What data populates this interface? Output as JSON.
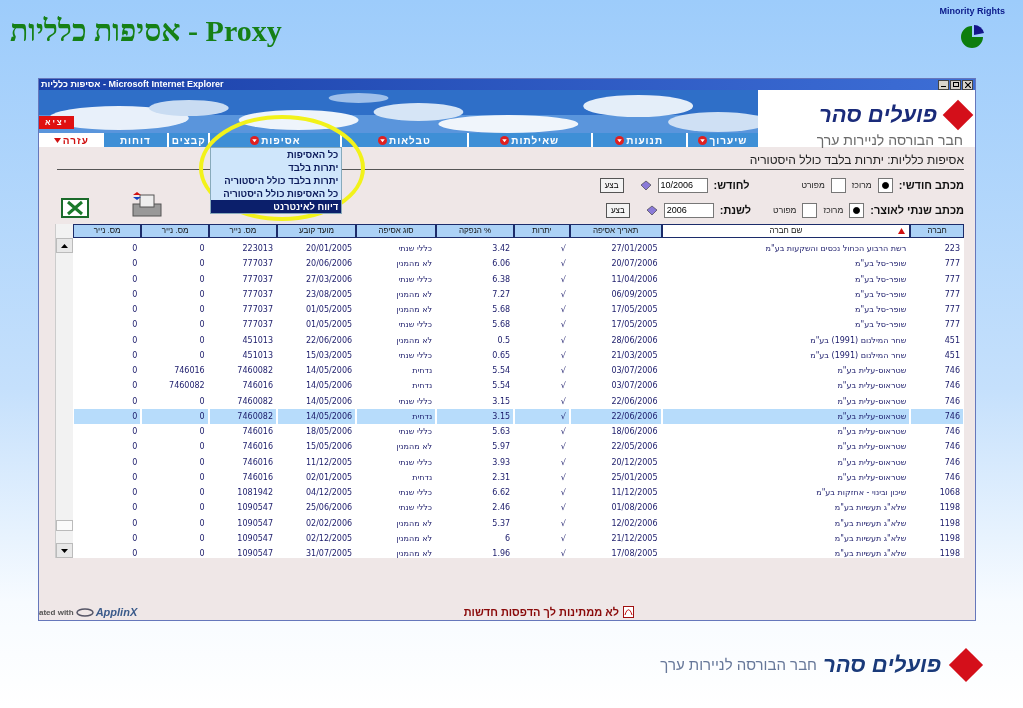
{
  "slide": {
    "title": "אסיפות כלליות - Proxy",
    "corner_label": "Minority Rights"
  },
  "window": {
    "title": "אסיפות כלליות - Microsoft Internet Explorer"
  },
  "banner": {
    "exit_button": "יציא",
    "logo_name": "פועלים סהר",
    "logo_tagline": "חבר הבורסה לניירות ערך"
  },
  "nav_tabs": [
    {
      "label": "שיערוך",
      "kind": "menu",
      "open": false
    },
    {
      "label": "תנועות",
      "kind": "menu",
      "open": false
    },
    {
      "label": "שאילתות",
      "kind": "menu",
      "open": false
    },
    {
      "label": "טבלאות",
      "kind": "menu",
      "open": false
    },
    {
      "label": "אסיפות",
      "kind": "menu",
      "open": true
    },
    {
      "label": "קבצים",
      "kind": "plain",
      "open": false
    },
    {
      "label": "דוחות",
      "kind": "plain",
      "open": false
    },
    {
      "label": "עזרה",
      "kind": "help",
      "open": false
    }
  ],
  "menu_items": [
    {
      "label": "כל האסיפות",
      "selected": false
    },
    {
      "label": "יתרות בלבד",
      "selected": false
    },
    {
      "label": "יתרות בלבד כולל היסטוריה",
      "selected": false
    },
    {
      "label": "כל האסיפות כולל היסטוריה",
      "selected": false
    },
    {
      "label": "דיווח לאינטרנט",
      "selected": true
    }
  ],
  "page_heading": "אסיפות כלליות: יתרות בלבד כולל היסטוריה",
  "forms": [
    {
      "label": "מכתב חודשי:",
      "options": [
        {
          "label": "מרוכז",
          "selected": true
        },
        {
          "label": "מפורט",
          "selected": false
        }
      ],
      "period_label": "לחודש:",
      "period_value": "10/2006",
      "button": "בצע"
    },
    {
      "label": "מכתב שנתי לאוצר:",
      "options": [
        {
          "label": "מרוכז",
          "selected": true
        },
        {
          "label": "מפורט",
          "selected": false
        }
      ],
      "period_label": "לשנת:",
      "period_value": "2006",
      "button": "בצע"
    }
  ],
  "table": {
    "columns": [
      {
        "label": "חברה",
        "sorted": false
      },
      {
        "label": "שם חברה",
        "sorted": true
      },
      {
        "label": "תאריך אסיפה",
        "sorted": false
      },
      {
        "label": "יתרות",
        "sorted": false
      },
      {
        "label": "% הנפקה",
        "sorted": false
      },
      {
        "label": "סוג אסיפה",
        "sorted": false
      },
      {
        "label": "מועד קובע",
        "sorted": false
      },
      {
        "label": "מס. נייר",
        "sorted": false
      },
      {
        "label": "מס. נייר",
        "sorted": false
      },
      {
        "label": "מס. נייר",
        "sorted": false
      }
    ],
    "rows": [
      {
        "selected": false,
        "cells": [
          "223",
          "רשת הרבוע הכחול נכסים והשקעות בע\"מ",
          "27/01/2005",
          "√",
          "3.42",
          "כללי שנתי",
          "20/01/2005",
          "223013",
          "0",
          "0"
        ]
      },
      {
        "selected": false,
        "cells": [
          "777",
          "שופר-סל בע\"מ",
          "20/07/2006",
          "√",
          "6.06",
          "לא מהמנין",
          "20/06/2006",
          "777037",
          "0",
          "0"
        ]
      },
      {
        "selected": false,
        "cells": [
          "777",
          "שופר-סל בע\"מ",
          "11/04/2006",
          "√",
          "6.38",
          "כללי שנתי",
          "27/03/2006",
          "777037",
          "0",
          "0"
        ]
      },
      {
        "selected": false,
        "cells": [
          "777",
          "שופר-סל בע\"מ",
          "06/09/2005",
          "√",
          "7.27",
          "לא מהמנין",
          "23/08/2005",
          "777037",
          "0",
          "0"
        ]
      },
      {
        "selected": false,
        "cells": [
          "777",
          "שופר-סל בע\"מ",
          "17/05/2005",
          "√",
          "5.68",
          "לא מהמנין",
          "01/05/2005",
          "777037",
          "0",
          "0"
        ]
      },
      {
        "selected": false,
        "cells": [
          "777",
          "שופר-סל בע\"מ",
          "17/05/2005",
          "√",
          "5.68",
          "כללי שנתי",
          "01/05/2005",
          "777037",
          "0",
          "0"
        ]
      },
      {
        "selected": false,
        "cells": [
          "451",
          "שחר המילנום (1991) בע\"מ",
          "28/06/2006",
          "√",
          "0.5",
          "לא מהמנין",
          "22/06/2006",
          "451013",
          "0",
          "0"
        ]
      },
      {
        "selected": false,
        "cells": [
          "451",
          "שחר המילנום (1991) בע\"מ",
          "21/03/2005",
          "√",
          "0.65",
          "כללי שנתי",
          "15/03/2005",
          "451013",
          "0",
          "0"
        ]
      },
      {
        "selected": false,
        "cells": [
          "746",
          "שטראוס-עלית בע\"מ",
          "03/07/2006",
          "√",
          "5.54",
          "נדחית",
          "14/05/2006",
          "7460082",
          "746016",
          "0"
        ]
      },
      {
        "selected": false,
        "cells": [
          "746",
          "שטראוס-עלית בע\"מ",
          "03/07/2006",
          "√",
          "5.54",
          "נדחית",
          "14/05/2006",
          "746016",
          "7460082",
          "0"
        ]
      },
      {
        "selected": false,
        "cells": [
          "746",
          "שטראוס-עלית בע\"מ",
          "22/06/2006",
          "√",
          "3.15",
          "כללי שנתי",
          "14/05/2006",
          "7460082",
          "0",
          "0"
        ]
      },
      {
        "selected": true,
        "cells": [
          "746",
          "שטראוס-עלית בע\"מ",
          "22/06/2006",
          "√",
          "3.15",
          "נדחית",
          "14/05/2006",
          "7460082",
          "0",
          "0"
        ]
      },
      {
        "selected": false,
        "cells": [
          "746",
          "שטראוס-עלית בע\"מ",
          "18/06/2006",
          "√",
          "5.63",
          "כללי שנתי",
          "18/05/2006",
          "746016",
          "0",
          "0"
        ]
      },
      {
        "selected": false,
        "cells": [
          "746",
          "שטראוס-עלית בע\"מ",
          "22/05/2006",
          "√",
          "5.97",
          "לא מהמנין",
          "15/05/2006",
          "746016",
          "0",
          "0"
        ]
      },
      {
        "selected": false,
        "cells": [
          "746",
          "שטראוס-עלית בע\"מ",
          "20/12/2005",
          "√",
          "3.93",
          "כללי שנתי",
          "11/12/2005",
          "746016",
          "0",
          "0"
        ]
      },
      {
        "selected": false,
        "cells": [
          "746",
          "שטראוס-עלית בע\"מ",
          "25/01/2005",
          "√",
          "2.31",
          "נדחית",
          "02/01/2005",
          "746016",
          "0",
          "0"
        ]
      },
      {
        "selected": false,
        "cells": [
          "1068",
          "שיכון ובינוי - אחזקות בע\"מ",
          "11/12/2005",
          "√",
          "6.62",
          "כללי שנתי",
          "04/12/2005",
          "1081942",
          "0",
          "0"
        ]
      },
      {
        "selected": false,
        "cells": [
          "1198",
          "שלא\"ג תעשיות בע\"מ",
          "01/08/2006",
          "√",
          "2.46",
          "כללי שנתי",
          "25/06/2006",
          "1090547",
          "0",
          "0"
        ]
      },
      {
        "selected": false,
        "cells": [
          "1198",
          "שלא\"ג תעשיות בע\"מ",
          "12/02/2006",
          "√",
          "5.37",
          "לא מהמנין",
          "02/02/2006",
          "1090547",
          "0",
          "0"
        ]
      },
      {
        "selected": false,
        "cells": [
          "1198",
          "שלא\"ג תעשיות בע\"מ",
          "21/12/2005",
          "√",
          "6",
          "לא מהמנין",
          "02/12/2005",
          "1090547",
          "0",
          "0"
        ]
      },
      {
        "selected": false,
        "cells": [
          "1198",
          "שלא\"ג תעשיות בע\"מ",
          "17/08/2005",
          "√",
          "1.96",
          "לא מהמנין",
          "31/07/2005",
          "1090547",
          "0",
          "0"
        ]
      }
    ]
  },
  "footer": {
    "generated_text": "ated with",
    "brand": "ApplinX",
    "message": "לא ממתינות לך הדפסות חדשות"
  },
  "bottom_logo": {
    "name": "פועלים סהר",
    "tagline": "חבר הבורסה לניירות ערך"
  }
}
